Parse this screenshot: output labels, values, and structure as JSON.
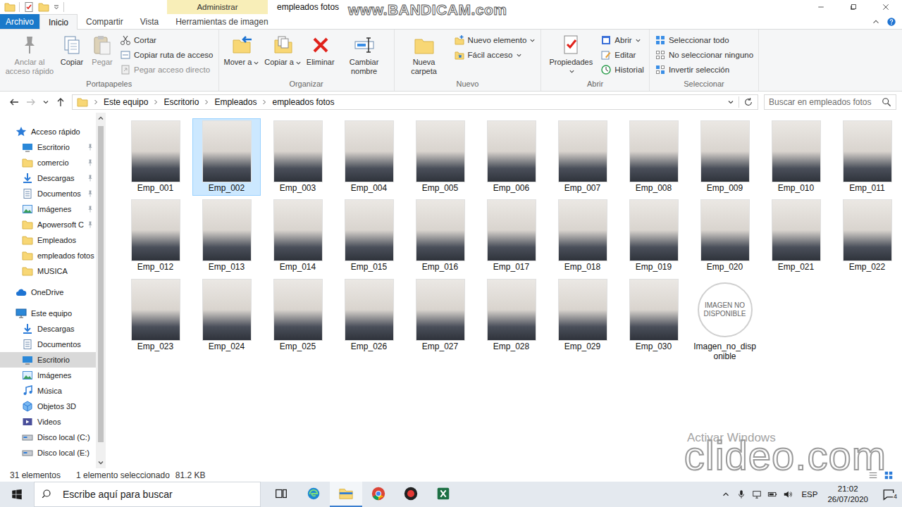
{
  "window": {
    "title": "empleados fotos",
    "context_tab": "Administrar"
  },
  "ribbon": {
    "tabs": [
      {
        "label": "Archivo",
        "kind": "file",
        "selected": false
      },
      {
        "label": "Inicio",
        "kind": "normal",
        "selected": true
      },
      {
        "label": "Compartir",
        "kind": "normal",
        "selected": false
      },
      {
        "label": "Vista",
        "kind": "normal",
        "selected": false
      },
      {
        "label": "Herramientas de imagen",
        "kind": "normal",
        "selected": false
      }
    ],
    "groups": [
      {
        "label": "Portapapeles",
        "buttons": [
          {
            "label": "Anclar al acceso rápido",
            "kind": "large",
            "disabled": true,
            "dropdown": false
          },
          {
            "label": "Copiar",
            "kind": "large",
            "disabled": false,
            "dropdown": false
          },
          {
            "label": "Pegar",
            "kind": "large",
            "disabled": true,
            "dropdown": false
          },
          {
            "label": "Cortar",
            "kind": "small",
            "disabled": false,
            "dropdown": false
          },
          {
            "label": "Copiar ruta de acceso",
            "kind": "small",
            "disabled": false,
            "dropdown": false
          },
          {
            "label": "Pegar acceso directo",
            "kind": "small",
            "disabled": true,
            "dropdown": false
          }
        ]
      },
      {
        "label": "Organizar",
        "buttons": [
          {
            "label": "Mover a",
            "kind": "large",
            "disabled": false,
            "dropdown": true
          },
          {
            "label": "Copiar a",
            "kind": "large",
            "disabled": false,
            "dropdown": true
          },
          {
            "label": "Eliminar",
            "kind": "large",
            "disabled": false,
            "dropdown": false
          },
          {
            "label": "Cambiar nombre",
            "kind": "large",
            "disabled": false,
            "dropdown": false
          }
        ]
      },
      {
        "label": "Nuevo",
        "buttons": [
          {
            "label": "Nueva carpeta",
            "kind": "large",
            "disabled": false,
            "dropdown": false
          },
          {
            "label": "Nuevo elemento",
            "kind": "small",
            "disabled": false,
            "dropdown": true
          },
          {
            "label": "Fácil acceso",
            "kind": "small",
            "disabled": false,
            "dropdown": true
          }
        ]
      },
      {
        "label": "Abrir",
        "buttons": [
          {
            "label": "Propiedades",
            "kind": "large",
            "disabled": false,
            "dropdown": true
          },
          {
            "label": "Abrir",
            "kind": "small",
            "disabled": false,
            "dropdown": true
          },
          {
            "label": "Editar",
            "kind": "small",
            "disabled": false,
            "dropdown": false
          },
          {
            "label": "Historial",
            "kind": "small",
            "disabled": false,
            "dropdown": false
          }
        ]
      },
      {
        "label": "Seleccionar",
        "buttons": [
          {
            "label": "Seleccionar todo",
            "kind": "small",
            "disabled": false,
            "dropdown": false
          },
          {
            "label": "No seleccionar ninguno",
            "kind": "small",
            "disabled": false,
            "dropdown": false
          },
          {
            "label": "Invertir selección",
            "kind": "small",
            "disabled": false,
            "dropdown": false
          }
        ]
      }
    ]
  },
  "address": {
    "path": [
      "Este equipo",
      "Escritorio",
      "Empleados",
      "empleados fotos"
    ],
    "search_placeholder": "Buscar en empleados fotos"
  },
  "nav": {
    "sections": [
      {
        "items": [
          {
            "label": "Acceso rápido",
            "kind": "star",
            "level": 0,
            "pinned": false,
            "selected": false
          },
          {
            "label": "Escritorio",
            "kind": "desktop",
            "level": 1,
            "pinned": true,
            "selected": false
          },
          {
            "label": "comercio",
            "kind": "folder",
            "level": 1,
            "pinned": true,
            "selected": false
          },
          {
            "label": "Descargas",
            "kind": "download",
            "level": 1,
            "pinned": true,
            "selected": false
          },
          {
            "label": "Documentos",
            "kind": "docs",
            "level": 1,
            "pinned": true,
            "selected": false
          },
          {
            "label": "Imágenes",
            "kind": "images",
            "level": 1,
            "pinned": true,
            "selected": false
          },
          {
            "label": "Apowersoft C",
            "kind": "folder",
            "level": 1,
            "pinned": true,
            "selected": false
          },
          {
            "label": "Empleados",
            "kind": "folder",
            "level": 1,
            "pinned": false,
            "selected": false
          },
          {
            "label": "empleados fotos",
            "kind": "folder",
            "level": 1,
            "pinned": false,
            "selected": false
          },
          {
            "label": "MUSICA",
            "kind": "folder",
            "level": 1,
            "pinned": false,
            "selected": false
          }
        ]
      },
      {
        "items": [
          {
            "label": "OneDrive",
            "kind": "cloud",
            "level": 0,
            "pinned": false,
            "selected": false
          }
        ]
      },
      {
        "items": [
          {
            "label": "Este equipo",
            "kind": "pc",
            "level": 0,
            "pinned": false,
            "selected": false
          },
          {
            "label": "Descargas",
            "kind": "download",
            "level": 1,
            "pinned": false,
            "selected": false
          },
          {
            "label": "Documentos",
            "kind": "docs",
            "level": 1,
            "pinned": false,
            "selected": false
          },
          {
            "label": "Escritorio",
            "kind": "desktop",
            "level": 1,
            "pinned": false,
            "selected": true
          },
          {
            "label": "Imágenes",
            "kind": "images",
            "level": 1,
            "pinned": false,
            "selected": false
          },
          {
            "label": "Música",
            "kind": "music",
            "level": 1,
            "pinned": false,
            "selected": false
          },
          {
            "label": "Objetos 3D",
            "kind": "objects3d",
            "level": 1,
            "pinned": false,
            "selected": false
          },
          {
            "label": "Videos",
            "kind": "video",
            "level": 1,
            "pinned": false,
            "selected": false
          },
          {
            "label": "Disco local (C:)",
            "kind": "drive",
            "level": 1,
            "pinned": false,
            "selected": false
          },
          {
            "label": "Disco local (E:)",
            "kind": "drive",
            "level": 1,
            "pinned": false,
            "selected": false
          }
        ]
      }
    ]
  },
  "files": [
    {
      "name": "Emp_001",
      "kind": "photo",
      "selected": false
    },
    {
      "name": "Emp_002",
      "kind": "photo",
      "selected": true
    },
    {
      "name": "Emp_003",
      "kind": "photo",
      "selected": false
    },
    {
      "name": "Emp_004",
      "kind": "photo",
      "selected": false
    },
    {
      "name": "Emp_005",
      "kind": "photo",
      "selected": false
    },
    {
      "name": "Emp_006",
      "kind": "photo",
      "selected": false
    },
    {
      "name": "Emp_007",
      "kind": "photo",
      "selected": false
    },
    {
      "name": "Emp_008",
      "kind": "photo",
      "selected": false
    },
    {
      "name": "Emp_009",
      "kind": "photo",
      "selected": false
    },
    {
      "name": "Emp_010",
      "kind": "photo",
      "selected": false
    },
    {
      "name": "Emp_011",
      "kind": "photo",
      "selected": false
    },
    {
      "name": "Emp_012",
      "kind": "photo",
      "selected": false
    },
    {
      "name": "Emp_013",
      "kind": "photo",
      "selected": false
    },
    {
      "name": "Emp_014",
      "kind": "photo",
      "selected": false
    },
    {
      "name": "Emp_015",
      "kind": "photo",
      "selected": false
    },
    {
      "name": "Emp_016",
      "kind": "photo",
      "selected": false
    },
    {
      "name": "Emp_017",
      "kind": "photo",
      "selected": false
    },
    {
      "name": "Emp_018",
      "kind": "photo",
      "selected": false
    },
    {
      "name": "Emp_019",
      "kind": "photo",
      "selected": false
    },
    {
      "name": "Emp_020",
      "kind": "photo",
      "selected": false
    },
    {
      "name": "Emp_021",
      "kind": "photo",
      "selected": false
    },
    {
      "name": "Emp_022",
      "kind": "photo",
      "selected": false
    },
    {
      "name": "Emp_023",
      "kind": "photo",
      "selected": false
    },
    {
      "name": "Emp_024",
      "kind": "photo",
      "selected": false
    },
    {
      "name": "Emp_025",
      "kind": "photo",
      "selected": false
    },
    {
      "name": "Emp_026",
      "kind": "photo",
      "selected": false
    },
    {
      "name": "Emp_027",
      "kind": "photo",
      "selected": false
    },
    {
      "name": "Emp_028",
      "kind": "photo",
      "selected": false
    },
    {
      "name": "Emp_029",
      "kind": "photo",
      "selected": false
    },
    {
      "name": "Emp_030",
      "kind": "photo",
      "selected": false
    },
    {
      "name": "Imagen_no_disponible",
      "kind": "placeholder",
      "thumb_text": "IMAGEN NO DISPONIBLE",
      "selected": false
    }
  ],
  "status_bar": {
    "item_count": "31 elementos",
    "selection": "1 elemento seleccionado",
    "size": "81.2 KB"
  },
  "taskbar": {
    "search_placeholder": "Escribe aquí para buscar",
    "apps": [
      {
        "kind": "taskview",
        "active": false
      },
      {
        "kind": "edge",
        "active": false
      },
      {
        "kind": "explorer",
        "active": true
      },
      {
        "kind": "chrome",
        "active": false
      },
      {
        "kind": "record",
        "active": false
      },
      {
        "kind": "excel",
        "active": false
      }
    ],
    "language": "ESP",
    "time": "21:02",
    "date": "26/07/2020",
    "notifications": "4"
  },
  "watermarks": {
    "recorder": "www.BANDICAM.com",
    "editor": "clideo.com",
    "activation": "Activar Windows"
  }
}
